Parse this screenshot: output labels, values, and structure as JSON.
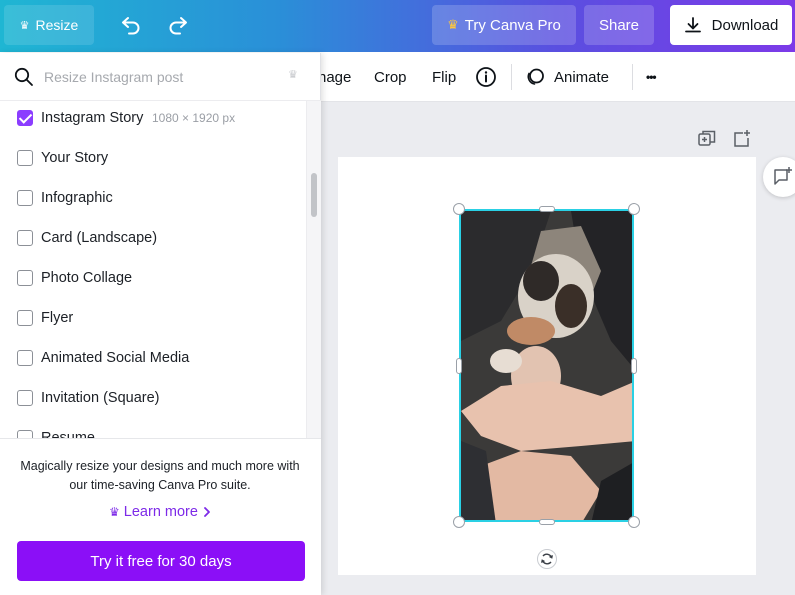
{
  "topbar": {
    "resize_label": "Resize",
    "try_pro_label": "Try Canva Pro",
    "share_label": "Share",
    "download_label": "Download",
    "crown_glyph": "♛",
    "pro_crown_color": "#ffc83d"
  },
  "toolbar": {
    "image_label_partial": "nage",
    "crop_label": "Crop",
    "flip_label": "Flip",
    "animate_label": "Animate",
    "more_glyph": "•••"
  },
  "resize_panel": {
    "search_placeholder": "Resize Instagram post",
    "items": [
      {
        "label": "Instagram Story",
        "dimensions": "1080 × 1920 px",
        "checked": true
      },
      {
        "label": "Your Story",
        "checked": false
      },
      {
        "label": "Infographic",
        "checked": false
      },
      {
        "label": "Card (Landscape)",
        "checked": false
      },
      {
        "label": "Photo Collage",
        "checked": false
      },
      {
        "label": "Flyer",
        "checked": false
      },
      {
        "label": "Animated Social Media",
        "checked": false
      },
      {
        "label": "Invitation (Square)",
        "checked": false
      },
      {
        "label": "Resume",
        "checked": false
      }
    ],
    "promo_text": "Magically resize your designs and much more with our time-saving Canva Pro suite.",
    "learn_more_label": "Learn more",
    "trial_button_label": "Try it free for 30 days",
    "accent_color": "#8b3dff"
  },
  "canvas": {
    "selection_color": "#2ad0e4",
    "background_color": "#ebecf0"
  }
}
